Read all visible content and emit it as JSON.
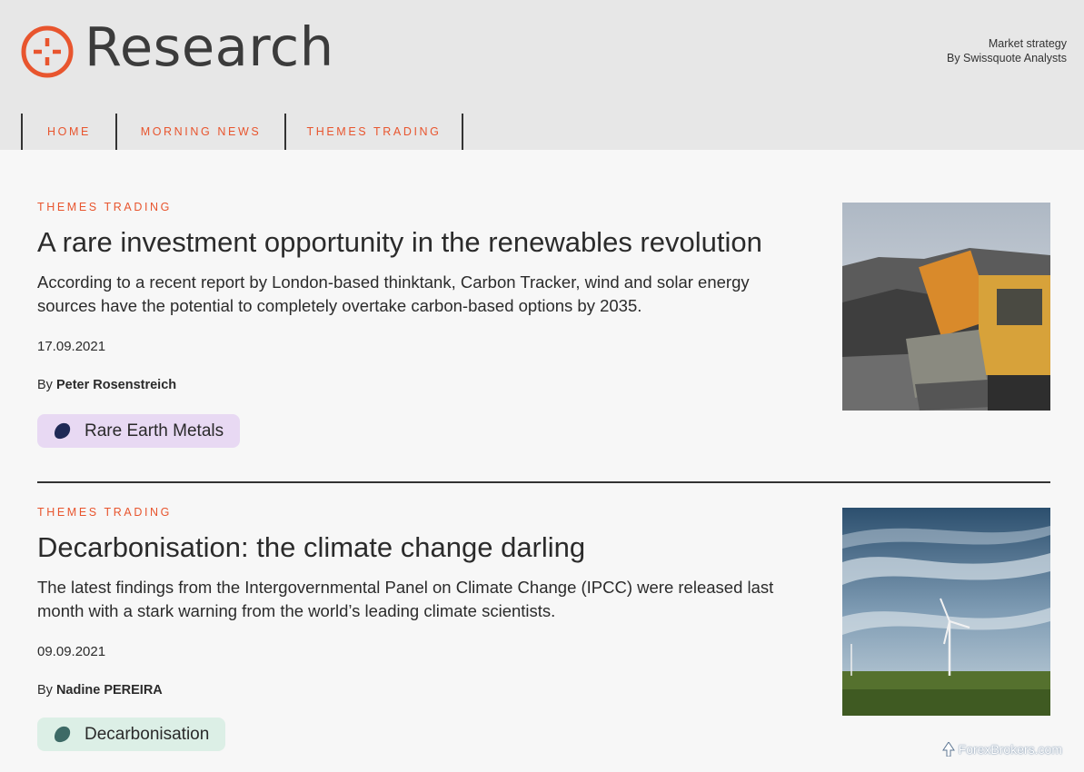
{
  "header": {
    "logo_text": "Research",
    "tagline_line1": "Market strategy",
    "tagline_line2": "By Swissquote Analysts"
  },
  "nav": {
    "items": [
      {
        "label": "HOME"
      },
      {
        "label": "MORNING NEWS"
      },
      {
        "label": "THEMES TRADING"
      }
    ]
  },
  "articles": [
    {
      "category": "THEMES TRADING",
      "title": "A rare investment opportunity in the renewables revolution",
      "summary": "According to a recent report by London-based thinktank, Carbon Tracker, wind and solar energy sources have the potential to completely overtake carbon-based options by 2035.",
      "date": "17.09.2021",
      "author_prefix": "By",
      "author": "Peter Rosenstreich",
      "tag": "Rare Earth Metals",
      "tag_color": "#e8d9f3",
      "tag_icon_color": "#1f2a56"
    },
    {
      "category": "THEMES TRADING",
      "title": "Decarbonisation: the climate change darling",
      "summary": "The latest findings from the Intergovernmental Panel on Climate Change (IPCC) were released last month with a stark warning from the world’s leading climate scientists.",
      "date": "09.09.2021",
      "author_prefix": "By",
      "author": "Nadine PEREIRA",
      "tag": "Decarbonisation",
      "tag_color": "#dcefe6",
      "tag_icon_color": "#3d6a66"
    }
  ],
  "watermark": "ForexBrokers.com",
  "colors": {
    "accent": "#e8552e",
    "header_bg": "#e7e7e7",
    "page_bg": "#f7f7f7"
  }
}
